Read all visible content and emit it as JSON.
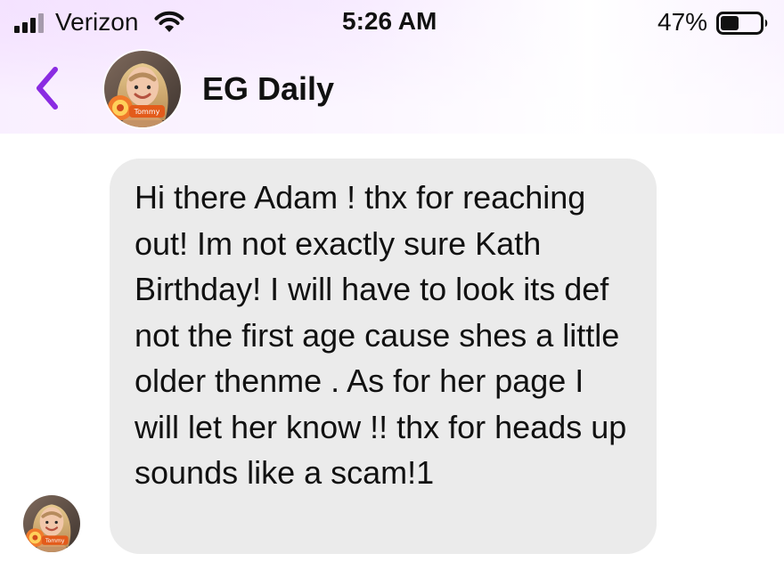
{
  "status_bar": {
    "carrier": "Verizon",
    "time": "5:26 AM",
    "battery_percent": "47%",
    "battery_level": 0.47,
    "signal_icon": "cellular-signal-icon",
    "wifi_icon": "wifi-icon",
    "battery_icon": "battery-icon"
  },
  "chat_header": {
    "back_icon": "chevron-left-icon",
    "contact_name": "EG Daily",
    "avatar_badge_text": "Tommy",
    "accent_color": "#8a2be2"
  },
  "messages": [
    {
      "direction": "incoming",
      "text": "Hi there Adam ! thx for reaching out! Im not exactly sure Kath Birthday! I will have to look its def not the first age cause shes a little older thenme . As for her page I will let her know !! thx for heads up sounds like a scam!1"
    }
  ]
}
